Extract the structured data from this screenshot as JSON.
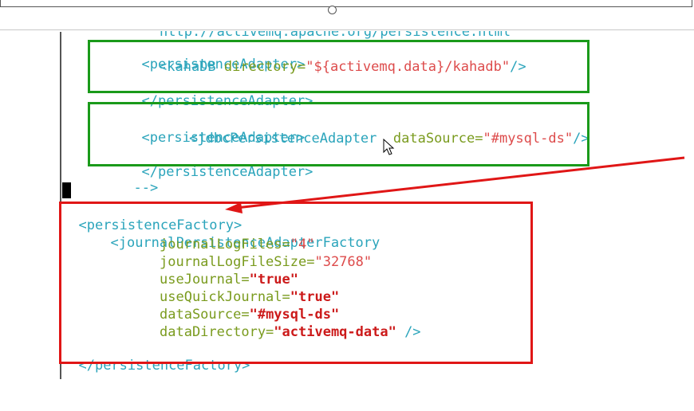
{
  "editor": {
    "partial_line": "http://activemq.apache.org/persistence.html",
    "block1": {
      "open": "<persistenceAdapter>",
      "inner_tag": "<kahaDB",
      "inner_attr": " directory=",
      "inner_val": "\"${activemq.data}/kahadb\"",
      "inner_close": "/>",
      "close": "</persistenceAdapter>"
    },
    "block2": {
      "open": "<persistenceAdapter>",
      "inner_tag": "<jdbcPersistenceAdapter",
      "inner_attr": " dataSource=",
      "inner_val": "\"#mysql-ds\"",
      "inner_close": "/>",
      "close": "</persistenceAdapter>",
      "comment_end": "-->"
    },
    "factory": {
      "open": "<persistenceFactory>",
      "inner_tag": "<journalPersistenceAdapterFactory",
      "attrs": [
        {
          "name": "journalLogFiles=",
          "value": "\"4\"",
          "bold": false
        },
        {
          "name": "journalLogFileSize=",
          "value": "\"32768\"",
          "bold": false
        },
        {
          "name": "useJournal=",
          "value": "\"true\"",
          "bold": true
        },
        {
          "name": "useQuickJournal=",
          "value": "\"true\"",
          "bold": true
        },
        {
          "name": "dataSource=",
          "value": "\"#mysql-ds\"",
          "bold": true
        },
        {
          "name": "dataDirectory=",
          "value": "\"activemq-data\"",
          "bold": true
        }
      ],
      "self_close": " />",
      "close": "</persistenceFactory>"
    }
  },
  "colors": {
    "tag": "#2aa4bb",
    "attribute": "#7a9b1e",
    "value": "#dd4b4b",
    "highlight_green": "#1a9a1a",
    "highlight_red": "#e01616"
  },
  "icons": {
    "cursor": "mouse-pointer-icon",
    "arrow": "red-arrow-annotation"
  }
}
